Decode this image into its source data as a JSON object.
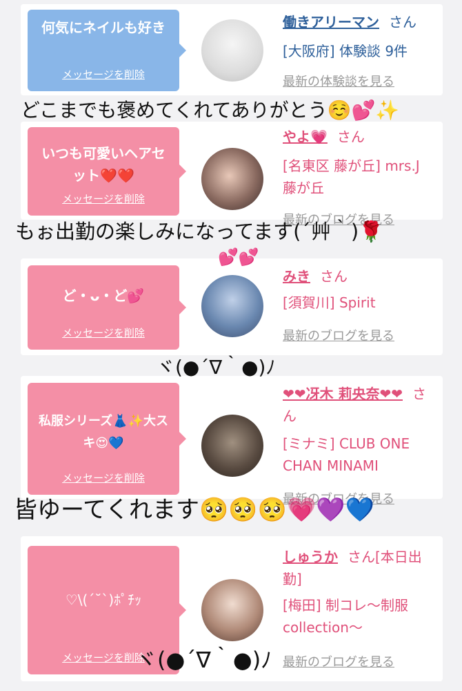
{
  "cards": [
    {
      "bubble_text": "何気にネイルも好き",
      "delete_label": "メッセージを削除",
      "name": "働きアリーマン",
      "san": "さん",
      "detail_lines": [
        "[大阪府] 体験談 9件"
      ],
      "latest_link": "最新の体験談を見る",
      "theme": "blue"
    },
    {
      "bubble_text": "いつも可愛いヘアセット❤️❤️",
      "delete_label": "メッセージを削除",
      "name": "やよ💗",
      "san": "さん",
      "detail_lines": [
        "[名東区 藤が丘] mrs.J",
        "藤が丘"
      ],
      "latest_link": "最新のブログを見る",
      "theme": "pink"
    },
    {
      "bubble_text": "ど・ᴗ・ど💕",
      "delete_label": "メッセージを削除",
      "name": "みき",
      "san": "さん",
      "detail_lines": [
        "[須賀川] Spirit"
      ],
      "latest_link": "最新のブログを見る",
      "theme": "pink"
    },
    {
      "bubble_text": "私服シリーズ👗✨大スキ😍💙",
      "delete_label": "メッセージを削除",
      "name": "❤❤冴木 莉央奈❤❤",
      "san": "さ",
      "san2": "ん",
      "detail_lines": [
        "[ミナミ] CLUB ONE",
        "CHAN MINAMI"
      ],
      "latest_link": "最新のブログを見る",
      "theme": "pink"
    },
    {
      "bubble_text": "♡\\(ˊ˘ˋ)ﾎﾟﾁｯ",
      "delete_label": "メッセージを削除",
      "name": "しゅうか",
      "san": "さん[本日出",
      "san2": "勤]",
      "detail_lines": [
        "[梅田] 制コレ～制服",
        "collection～"
      ],
      "latest_link": "最新のブログを見る",
      "theme": "pink"
    }
  ],
  "overlays": {
    "line1": "どこまでも褒めてくれてありがとう☺️💕✨",
    "line2": "もぉ出勤の楽しみになってます(´艸｀)🌹",
    "hearts": "💕💕",
    "line3": "ヾ(●´∇｀●)ﾉ",
    "line4": "皆ゆーてくれます🥺🥺🥺💗💜💙",
    "line5": "ヾ(●´∇｀●)ﾉ"
  },
  "colors": {
    "bubble_blue": "#89b6e8",
    "bubble_pink": "#f48fa6",
    "name_blue": "#2d5f9a",
    "name_pink": "#e0507a"
  },
  "icons": {
    "avatars": [
      "document-photo-avatar",
      "woman-avatar",
      "woman-avatar",
      "woman-avatar",
      "woman-avatar"
    ]
  }
}
